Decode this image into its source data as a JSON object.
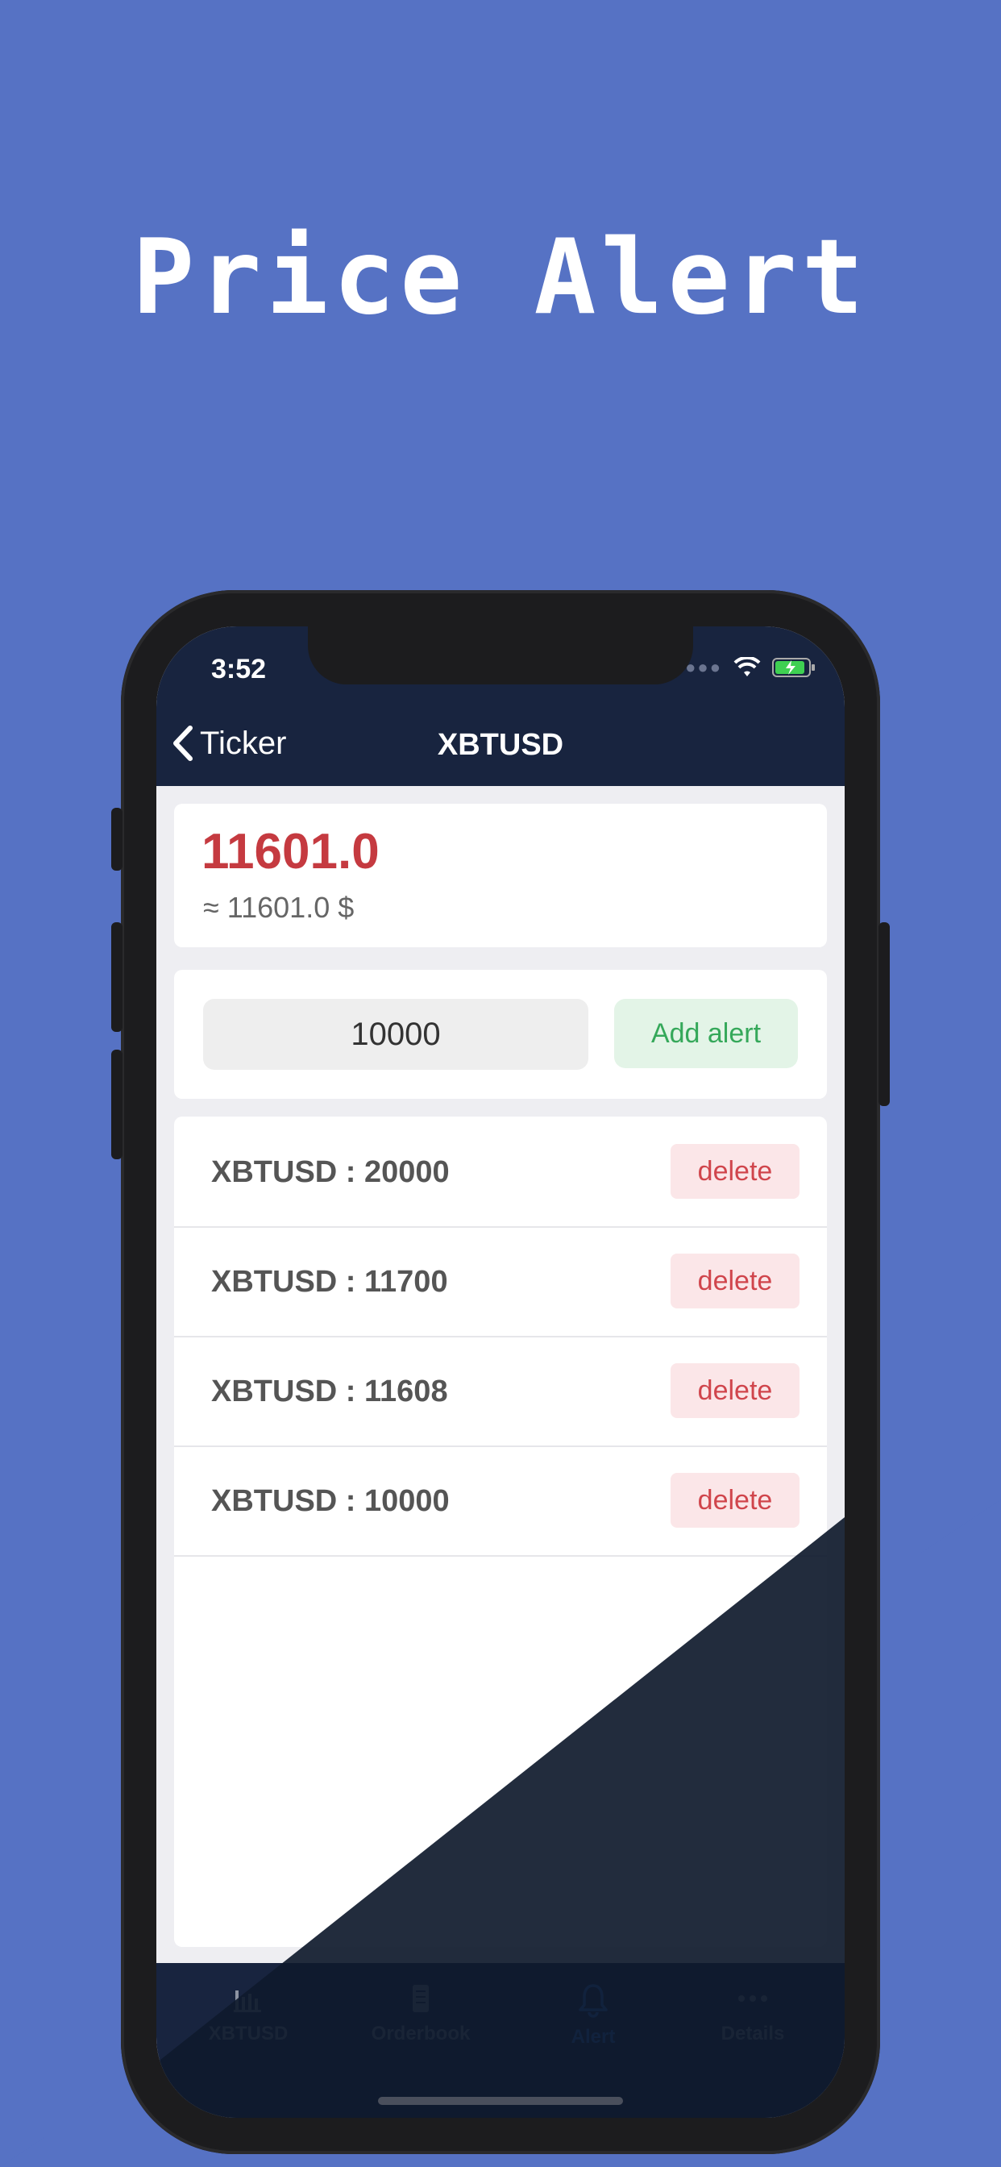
{
  "headline": "Price Alert",
  "status": {
    "time": "3:52"
  },
  "nav": {
    "back_label": "Ticker",
    "title": "XBTUSD"
  },
  "ticker": {
    "price": "11601.0",
    "price_usd": "≈ 11601.0 $"
  },
  "alert_form": {
    "input_value": "10000",
    "add_label": "Add alert"
  },
  "alerts": [
    {
      "label": "XBTUSD : 20000",
      "action": "delete"
    },
    {
      "label": "XBTUSD : 11700",
      "action": "delete"
    },
    {
      "label": "XBTUSD : 11608",
      "action": "delete"
    },
    {
      "label": "XBTUSD : 10000",
      "action": "delete"
    }
  ],
  "tabs": [
    {
      "label": "XBTUSD",
      "icon": "chart-icon",
      "active": false
    },
    {
      "label": "Orderbook",
      "icon": "book-icon",
      "active": false
    },
    {
      "label": "Alert",
      "icon": "bell-icon",
      "active": true
    },
    {
      "label": "Details",
      "icon": "more-icon",
      "active": false
    }
  ],
  "colors": {
    "background": "#5672C4",
    "navbar": "#18243F",
    "price_red": "#C53A40",
    "add_green": "#35A85A",
    "delete_red": "#D0454C",
    "active_tab": "#2F7BF6"
  }
}
